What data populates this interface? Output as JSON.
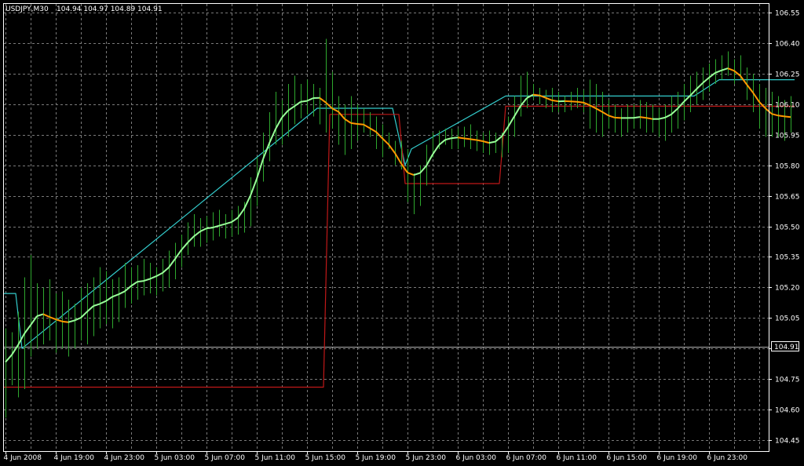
{
  "header": {
    "symbol": "USDJPY,M30",
    "ohlc": "104.94 104.97 104.89 104.91"
  },
  "colors": {
    "background": "#000000",
    "grid": "#7a7a7a",
    "bars": "#2ea82e",
    "stop_line": "#c01818",
    "upper_envelope": "#33cccc",
    "trend_up": "#99ff99",
    "trend_down": "#ff9900",
    "frame": "#ffffff"
  },
  "chart_data": {
    "type": "bar",
    "title": "USDJPY,M30",
    "subtitle": "104.94 104.97 104.89 104.91",
    "ylim": [
      104.4,
      106.62
    ],
    "y_ticks": [
      104.45,
      104.6,
      104.75,
      104.9,
      105.05,
      105.2,
      105.35,
      105.5,
      105.65,
      105.8,
      105.95,
      106.1,
      106.25,
      106.4,
      106.55
    ],
    "y_tick_labels": [
      "104.45",
      "104.60",
      "104.75",
      "104.90",
      "105.05",
      "105.20",
      "105.35",
      "105.50",
      "105.65",
      "105.80",
      "105.95",
      "106.10",
      "106.25",
      "106.40",
      "106.55"
    ],
    "x_tick_labels": [
      {
        "bar": 0,
        "label": "4 Jun 2008"
      },
      {
        "bar": 8,
        "label": "4 Jun 19:00"
      },
      {
        "bar": 16,
        "label": "4 Jun 23:00"
      },
      {
        "bar": 24,
        "label": "5 Jun 03:00"
      },
      {
        "bar": 32,
        "label": "5 Jun 07:00"
      },
      {
        "bar": 40,
        "label": "5 Jun 11:00"
      },
      {
        "bar": 48,
        "label": "5 Jun 15:00"
      },
      {
        "bar": 56,
        "label": "5 Jun 19:00"
      },
      {
        "bar": 64,
        "label": "5 Jun 23:00"
      },
      {
        "bar": 72,
        "label": "6 Jun 03:00"
      },
      {
        "bar": 80,
        "label": "6 Jun 07:00"
      },
      {
        "bar": 88,
        "label": "6 Jun 11:00"
      },
      {
        "bar": 96,
        "label": "6 Jun 15:00"
      },
      {
        "bar": 104,
        "label": "6 Jun 19:00"
      },
      {
        "bar": 112,
        "label": "6 Jun 23:00"
      }
    ],
    "bid_price": 104.91,
    "bid_label": "104.91",
    "grid": true,
    "bars": [
      {
        "x": 0,
        "h": 105.0,
        "l": 104.56
      },
      {
        "x": 1,
        "h": 104.98,
        "l": 104.72
      },
      {
        "x": 2,
        "h": 105.08,
        "l": 104.66
      },
      {
        "x": 3,
        "h": 105.25,
        "l": 104.7
      },
      {
        "x": 4,
        "h": 105.36,
        "l": 104.86
      },
      {
        "x": 5,
        "h": 105.22,
        "l": 104.9
      },
      {
        "x": 6,
        "h": 105.2,
        "l": 104.92
      },
      {
        "x": 7,
        "h": 105.24,
        "l": 104.94
      },
      {
        "x": 8,
        "h": 105.17,
        "l": 104.88
      },
      {
        "x": 9,
        "h": 105.18,
        "l": 104.9
      },
      {
        "x": 10,
        "h": 105.14,
        "l": 104.86
      },
      {
        "x": 11,
        "h": 105.12,
        "l": 104.9
      },
      {
        "x": 12,
        "h": 105.2,
        "l": 104.94
      },
      {
        "x": 13,
        "h": 105.22,
        "l": 104.92
      },
      {
        "x": 14,
        "h": 105.25,
        "l": 104.96
      },
      {
        "x": 15,
        "h": 105.3,
        "l": 105.0
      },
      {
        "x": 16,
        "h": 105.28,
        "l": 105.02
      },
      {
        "x": 17,
        "h": 105.24,
        "l": 105.0
      },
      {
        "x": 18,
        "h": 105.25,
        "l": 105.03
      },
      {
        "x": 19,
        "h": 105.32,
        "l": 105.1
      },
      {
        "x": 20,
        "h": 105.3,
        "l": 105.12
      },
      {
        "x": 21,
        "h": 105.31,
        "l": 105.14
      },
      {
        "x": 22,
        "h": 105.34,
        "l": 105.16
      },
      {
        "x": 23,
        "h": 105.32,
        "l": 105.17
      },
      {
        "x": 24,
        "h": 105.3,
        "l": 105.16
      },
      {
        "x": 25,
        "h": 105.34,
        "l": 105.18
      },
      {
        "x": 26,
        "h": 105.38,
        "l": 105.2
      },
      {
        "x": 27,
        "h": 105.42,
        "l": 105.24
      },
      {
        "x": 28,
        "h": 105.46,
        "l": 105.3
      },
      {
        "x": 29,
        "h": 105.52,
        "l": 105.36
      },
      {
        "x": 30,
        "h": 105.56,
        "l": 105.4
      },
      {
        "x": 31,
        "h": 105.54,
        "l": 105.4
      },
      {
        "x": 32,
        "h": 105.55,
        "l": 105.42
      },
      {
        "x": 33,
        "h": 105.57,
        "l": 105.43
      },
      {
        "x": 34,
        "h": 105.58,
        "l": 105.45
      },
      {
        "x": 35,
        "h": 105.56,
        "l": 105.44
      },
      {
        "x": 36,
        "h": 105.58,
        "l": 105.45
      },
      {
        "x": 37,
        "h": 105.6,
        "l": 105.46
      },
      {
        "x": 38,
        "h": 105.62,
        "l": 105.47
      },
      {
        "x": 39,
        "h": 105.74,
        "l": 105.5
      },
      {
        "x": 40,
        "h": 105.84,
        "l": 105.6
      },
      {
        "x": 41,
        "h": 105.96,
        "l": 105.72
      },
      {
        "x": 42,
        "h": 106.06,
        "l": 105.82
      },
      {
        "x": 43,
        "h": 106.16,
        "l": 105.9
      },
      {
        "x": 44,
        "h": 106.12,
        "l": 105.9
      },
      {
        "x": 45,
        "h": 106.2,
        "l": 105.94
      },
      {
        "x": 46,
        "h": 106.24,
        "l": 106.0
      },
      {
        "x": 47,
        "h": 106.2,
        "l": 106.03
      },
      {
        "x": 48,
        "h": 106.22,
        "l": 106.05
      },
      {
        "x": 49,
        "h": 106.2,
        "l": 106.04
      },
      {
        "x": 50,
        "h": 106.18,
        "l": 106.0
      },
      {
        "x": 51,
        "h": 106.42,
        "l": 105.96
      },
      {
        "x": 52,
        "h": 106.26,
        "l": 105.98
      },
      {
        "x": 53,
        "h": 106.14,
        "l": 105.9
      },
      {
        "x": 54,
        "h": 106.1,
        "l": 105.85
      },
      {
        "x": 55,
        "h": 106.14,
        "l": 105.88
      },
      {
        "x": 56,
        "h": 106.1,
        "l": 105.92
      },
      {
        "x": 57,
        "h": 106.08,
        "l": 105.96
      },
      {
        "x": 58,
        "h": 106.06,
        "l": 105.94
      },
      {
        "x": 59,
        "h": 106.04,
        "l": 105.88
      },
      {
        "x": 60,
        "h": 106.0,
        "l": 105.84
      },
      {
        "x": 61,
        "h": 105.96,
        "l": 105.88
      },
      {
        "x": 62,
        "h": 105.92,
        "l": 105.8
      },
      {
        "x": 63,
        "h": 105.92,
        "l": 105.78
      },
      {
        "x": 64,
        "h": 105.88,
        "l": 105.62
      },
      {
        "x": 65,
        "h": 105.76,
        "l": 105.56
      },
      {
        "x": 66,
        "h": 105.8,
        "l": 105.6
      },
      {
        "x": 67,
        "h": 105.9,
        "l": 105.7
      },
      {
        "x": 68,
        "h": 105.96,
        "l": 105.84
      },
      {
        "x": 69,
        "h": 105.97,
        "l": 105.88
      },
      {
        "x": 70,
        "h": 105.98,
        "l": 105.9
      },
      {
        "x": 71,
        "h": 105.98,
        "l": 105.88
      },
      {
        "x": 72,
        "h": 105.98,
        "l": 105.88
      },
      {
        "x": 73,
        "h": 105.99,
        "l": 105.89
      },
      {
        "x": 74,
        "h": 106.0,
        "l": 105.88
      },
      {
        "x": 75,
        "h": 105.97,
        "l": 105.87
      },
      {
        "x": 76,
        "h": 105.96,
        "l": 105.86
      },
      {
        "x": 77,
        "h": 105.97,
        "l": 105.85
      },
      {
        "x": 78,
        "h": 105.96,
        "l": 105.86
      },
      {
        "x": 79,
        "h": 105.96,
        "l": 105.84
      },
      {
        "x": 80,
        "h": 106.04,
        "l": 105.86
      },
      {
        "x": 81,
        "h": 106.14,
        "l": 105.94
      },
      {
        "x": 82,
        "h": 106.24,
        "l": 106.04
      },
      {
        "x": 83,
        "h": 106.26,
        "l": 106.08
      },
      {
        "x": 84,
        "h": 106.2,
        "l": 106.12
      },
      {
        "x": 85,
        "h": 106.18,
        "l": 106.1
      },
      {
        "x": 86,
        "h": 106.17,
        "l": 106.08
      },
      {
        "x": 87,
        "h": 106.18,
        "l": 106.06
      },
      {
        "x": 88,
        "h": 106.16,
        "l": 106.06
      },
      {
        "x": 89,
        "h": 106.14,
        "l": 106.06
      },
      {
        "x": 90,
        "h": 106.16,
        "l": 106.07
      },
      {
        "x": 91,
        "h": 106.18,
        "l": 106.08
      },
      {
        "x": 92,
        "h": 106.17,
        "l": 106.06
      },
      {
        "x": 93,
        "h": 106.22,
        "l": 105.98
      },
      {
        "x": 94,
        "h": 106.2,
        "l": 105.96
      },
      {
        "x": 95,
        "h": 106.16,
        "l": 105.94
      },
      {
        "x": 96,
        "h": 106.12,
        "l": 105.98
      },
      {
        "x": 97,
        "h": 106.1,
        "l": 105.96
      },
      {
        "x": 98,
        "h": 106.08,
        "l": 105.94
      },
      {
        "x": 99,
        "h": 106.1,
        "l": 105.96
      },
      {
        "x": 100,
        "h": 106.1,
        "l": 105.98
      },
      {
        "x": 101,
        "h": 106.12,
        "l": 105.98
      },
      {
        "x": 102,
        "h": 106.11,
        "l": 105.96
      },
      {
        "x": 103,
        "h": 106.1,
        "l": 105.96
      },
      {
        "x": 104,
        "h": 106.08,
        "l": 105.94
      },
      {
        "x": 105,
        "h": 106.1,
        "l": 105.92
      },
      {
        "x": 106,
        "h": 106.14,
        "l": 105.96
      },
      {
        "x": 107,
        "h": 106.16,
        "l": 105.98
      },
      {
        "x": 108,
        "h": 106.2,
        "l": 106.02
      },
      {
        "x": 109,
        "h": 106.24,
        "l": 106.06
      },
      {
        "x": 110,
        "h": 106.26,
        "l": 106.1
      },
      {
        "x": 111,
        "h": 106.28,
        "l": 106.12
      },
      {
        "x": 112,
        "h": 106.3,
        "l": 106.16
      },
      {
        "x": 113,
        "h": 106.32,
        "l": 106.2
      },
      {
        "x": 114,
        "h": 106.34,
        "l": 106.22
      },
      {
        "x": 115,
        "h": 106.36,
        "l": 106.24
      },
      {
        "x": 116,
        "h": 106.32,
        "l": 106.2
      },
      {
        "x": 117,
        "h": 106.34,
        "l": 106.22
      },
      {
        "x": 118,
        "h": 106.28,
        "l": 106.12
      },
      {
        "x": 119,
        "h": 106.25,
        "l": 106.06
      },
      {
        "x": 120,
        "h": 106.2,
        "l": 105.98
      },
      {
        "x": 121,
        "h": 106.18,
        "l": 105.94
      },
      {
        "x": 122,
        "h": 106.16,
        "l": 105.94
      },
      {
        "x": 123,
        "h": 106.14,
        "l": 105.94
      },
      {
        "x": 124,
        "h": 106.12,
        "l": 105.92
      },
      {
        "x": 125,
        "h": 106.14,
        "l": 105.96
      }
    ],
    "series": [
      {
        "name": "",
        "color": "#33cccc",
        "x": [
          0,
          2,
          3,
          50,
          62,
          64,
          65,
          80,
          91,
          110,
          111,
          112,
          113,
          114,
          115,
          116,
          117,
          119,
          120,
          121,
          122,
          123,
          124,
          125,
          126
        ],
        "y": [
          105.17,
          105.17,
          104.9,
          106.08,
          106.08,
          105.8,
          105.88,
          106.14,
          106.14,
          106.14,
          106.16,
          106.18,
          106.2,
          106.22,
          106.22,
          106.22,
          106.22,
          106.22,
          106.22,
          106.22,
          106.22,
          106.22,
          106.22,
          106.22,
          106.22
        ]
      },
      {
        "name": "",
        "color": "#c01818",
        "x": [
          0,
          51,
          52,
          63,
          64,
          79,
          80,
          95,
          96,
          126
        ],
        "y": [
          104.71,
          104.71,
          106.05,
          106.05,
          105.71,
          105.71,
          106.09,
          106.09,
          106.09,
          106.09
        ]
      }
    ]
  }
}
